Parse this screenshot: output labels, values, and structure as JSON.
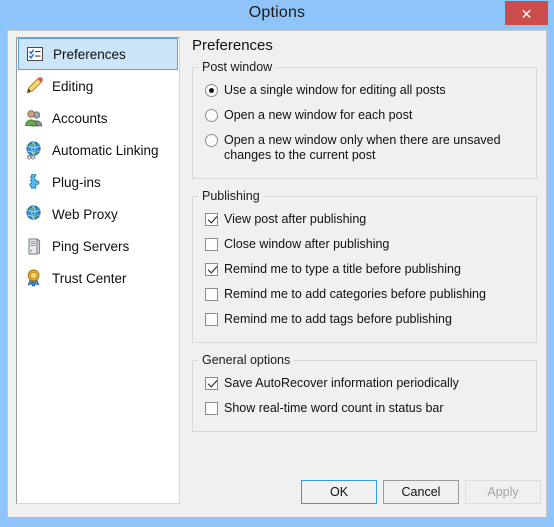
{
  "window": {
    "title": "Options",
    "close_label": "✕"
  },
  "sidebar": {
    "items": [
      {
        "label": "Preferences",
        "icon": "preferences-checklist-icon",
        "selected": true
      },
      {
        "label": "Editing",
        "icon": "pencil-icon",
        "selected": false
      },
      {
        "label": "Accounts",
        "icon": "users-icon",
        "selected": false
      },
      {
        "label": "Automatic Linking",
        "icon": "globe-link-icon",
        "selected": false
      },
      {
        "label": "Plug-ins",
        "icon": "puzzle-piece-icon",
        "selected": false
      },
      {
        "label": "Web Proxy",
        "icon": "globe-icon",
        "selected": false
      },
      {
        "label": "Ping Servers",
        "icon": "server-icon",
        "selected": false
      },
      {
        "label": "Trust Center",
        "icon": "medal-icon",
        "selected": false
      }
    ]
  },
  "pane": {
    "title": "Preferences",
    "groups": [
      {
        "legend": "Post window",
        "type": "radio",
        "options": [
          {
            "label": "Use a single window for editing all posts",
            "checked": true
          },
          {
            "label": "Open a new window for each post",
            "checked": false
          },
          {
            "label": "Open a new window only when there are unsaved changes to the current post",
            "checked": false
          }
        ]
      },
      {
        "legend": "Publishing",
        "type": "checkbox",
        "options": [
          {
            "label": "View post after publishing",
            "checked": true
          },
          {
            "label": "Close window after publishing",
            "checked": false
          },
          {
            "label": "Remind me to type a title before publishing",
            "checked": true
          },
          {
            "label": "Remind me to add categories before publishing",
            "checked": false
          },
          {
            "label": "Remind me to add tags before publishing",
            "checked": false
          }
        ]
      },
      {
        "legend": "General options",
        "type": "checkbox",
        "options": [
          {
            "label": "Save AutoRecover information periodically",
            "checked": true
          },
          {
            "label": "Show real-time word count in status bar",
            "checked": false
          }
        ]
      }
    ]
  },
  "buttons": {
    "ok": "OK",
    "cancel": "Cancel",
    "apply": "Apply"
  },
  "colors": {
    "titlebar": "#8ec4fa",
    "close_button": "#cc4b4b",
    "dialog_background": "#f0f0f0",
    "selection": "#cce4f7",
    "selection_border": "#5ba3de",
    "default_button_border": "#3c99e0"
  }
}
